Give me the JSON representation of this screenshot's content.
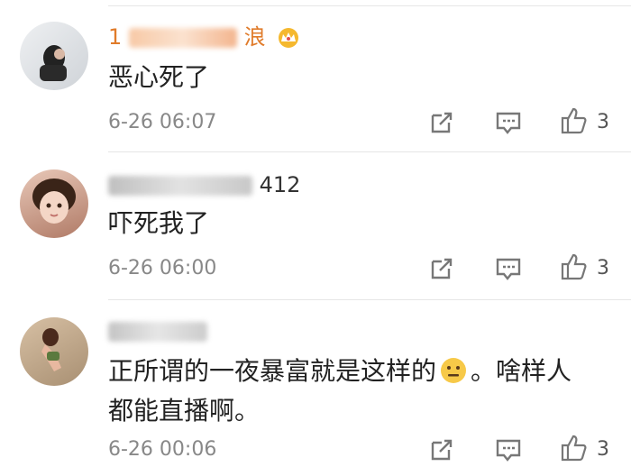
{
  "comments": [
    {
      "user": {
        "name_visible_start": "1",
        "name_visible_end": "浪",
        "badge_icon": "crown-icon"
      },
      "text": "恶心死了",
      "time": "6-26 06:07",
      "likes": "3",
      "avatar": "avatar-photo"
    },
    {
      "user": {
        "name_visible_start": "",
        "name_visible_end": "412",
        "badge_icon": ""
      },
      "text": "吓死我了",
      "time": "6-26 06:00",
      "likes": "3",
      "avatar": "avatar-photo"
    },
    {
      "user": {
        "name_visible_start": "",
        "name_visible_end": "",
        "badge_icon": ""
      },
      "text_part1": "正所谓的一夜暴富就是这样的",
      "text_emoji": "neutral-face-emoji",
      "text_part2": "。啥样人都能直播啊。",
      "time": "6-26 00:06",
      "likes": "3",
      "avatar": "avatar-photo"
    }
  ],
  "icons": {
    "share": "share-icon",
    "reply": "comment-icon",
    "like": "thumbs-up-icon"
  },
  "colors": {
    "username": "#e07b2a",
    "time": "#888888",
    "text": "#222222"
  }
}
